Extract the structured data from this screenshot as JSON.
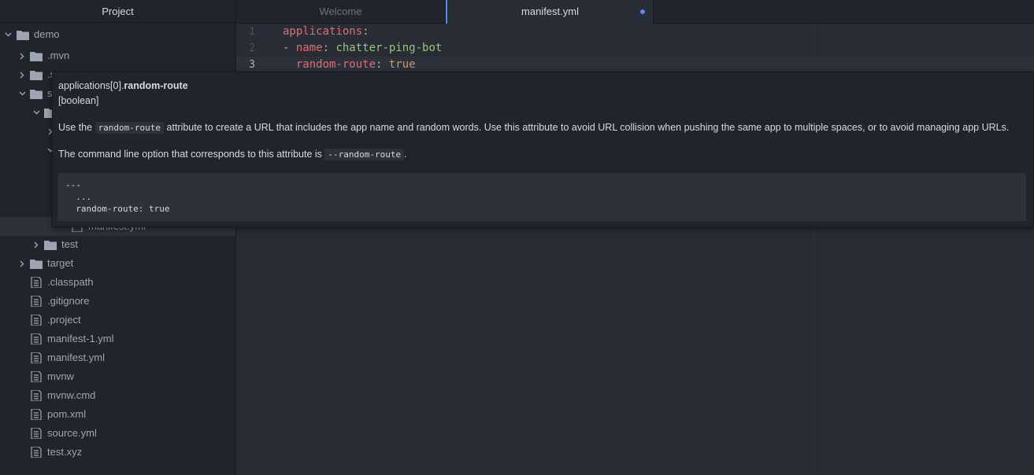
{
  "sidebar": {
    "title": "Project",
    "items": [
      {
        "label": "demo",
        "type": "folder",
        "expanded": true
      },
      {
        "label": ".mvn",
        "type": "folder",
        "expanded": false
      },
      {
        "label": ".s",
        "type": "folder",
        "expanded": false
      },
      {
        "label": "s",
        "type": "folder",
        "expanded": true
      },
      {
        "label": "",
        "type": "folder",
        "expanded": true
      },
      {
        "label": "",
        "type": "folder",
        "expanded": false
      },
      {
        "label": "",
        "type": "folder",
        "expanded": true
      },
      {
        "label": "manifest.yml",
        "type": "file",
        "selected": true
      },
      {
        "label": "test",
        "type": "folder",
        "expanded": false
      },
      {
        "label": "target",
        "type": "folder",
        "expanded": false
      },
      {
        "label": ".classpath",
        "type": "file"
      },
      {
        "label": ".gitignore",
        "type": "file"
      },
      {
        "label": ".project",
        "type": "file"
      },
      {
        "label": "manifest-1.yml",
        "type": "file"
      },
      {
        "label": "manifest.yml",
        "type": "file"
      },
      {
        "label": "mvnw",
        "type": "file"
      },
      {
        "label": "mvnw.cmd",
        "type": "file"
      },
      {
        "label": "pom.xml",
        "type": "file"
      },
      {
        "label": "source.yml",
        "type": "file"
      },
      {
        "label": "test.xyz",
        "type": "file"
      }
    ]
  },
  "tabs": [
    {
      "label": "Welcome",
      "active": false
    },
    {
      "label": "manifest.yml",
      "active": true,
      "modified": true
    }
  ],
  "editor": {
    "lines": [
      {
        "number": "1",
        "key": "applications",
        "colon": ":"
      },
      {
        "number": "2",
        "dash": "- ",
        "key": "name",
        "colon": ": ",
        "value": "chatter-ping-bot"
      },
      {
        "number": "3",
        "indent": "  ",
        "key": "random-route",
        "colon": ": ",
        "value": "true"
      }
    ]
  },
  "hover": {
    "path_prefix": "applications[0].",
    "path_name": "random-route",
    "type": "[boolean]",
    "desc1_pre": "Use the ",
    "desc1_code": "random-route",
    "desc1_post": " attribute to create a URL that includes the app name and random words. Use this attribute to avoid URL collision when pushing the same app to multiple spaces, or to avoid managing app URLs.",
    "desc2_pre": "The command line option that corresponds to this attribute is ",
    "desc2_code": "--random-route",
    "desc2_post": ".",
    "example": [
      "---",
      "  ...",
      "  random-route: true"
    ]
  },
  "colors": {
    "accent": "#568af2",
    "yaml_key": "#e06c75",
    "yaml_string": "#98c379",
    "yaml_boolean": "#d19a66"
  }
}
